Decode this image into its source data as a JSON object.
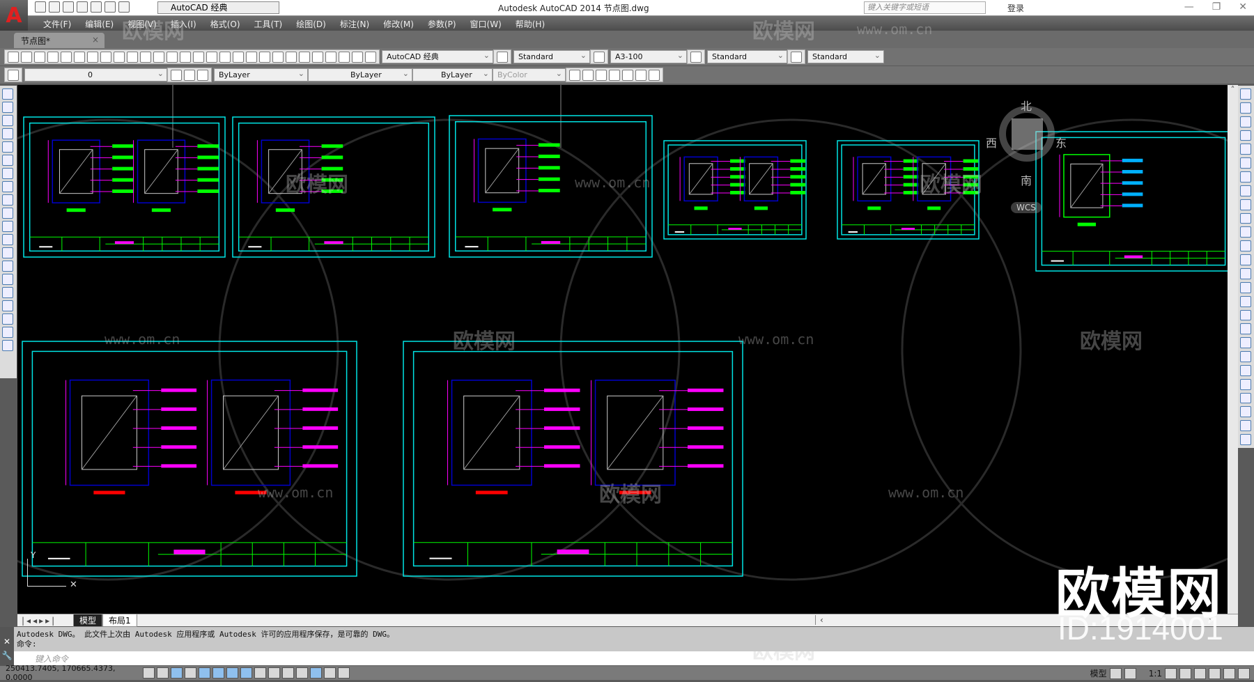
{
  "titlebar": {
    "workspace": "AutoCAD 经典",
    "title": "Autodesk AutoCAD 2014    节点图.dwg",
    "search_placeholder": "键入关键字或短语",
    "login": "登录"
  },
  "menu": [
    "文件(F)",
    "编辑(E)",
    "视图(V)",
    "插入(I)",
    "格式(O)",
    "工具(T)",
    "绘图(D)",
    "标注(N)",
    "修改(M)",
    "参数(P)",
    "窗口(W)",
    "帮助(H)"
  ],
  "doc_tab": "节点图*",
  "toolbar1": {
    "workspace": "AutoCAD 经典",
    "text_style": "Standard",
    "dim_style": "A3-100",
    "table_style": "Standard",
    "mleader_style": "Standard"
  },
  "toolbar2": {
    "layer": "0",
    "color": "ByLayer",
    "linetype": "ByLayer",
    "lineweight": "ByLayer",
    "plot_style": "ByColor"
  },
  "viewcube": {
    "north": "北",
    "south": "南",
    "east": "东",
    "west": "西",
    "wcs": "WCS"
  },
  "layout_tabs": [
    "模型",
    "布局1"
  ],
  "command": {
    "history": "Autodesk DWG。  此文件上次由 Autodesk 应用程序或 Autodesk 许可的应用程序保存，是可靠的 DWG。",
    "prompt": "命令:",
    "placeholder": "键入命令"
  },
  "status": {
    "coords": "250413.7405, 170665.4373, 0.0000",
    "model": "模型",
    "scale": "1:1"
  },
  "watermark": {
    "brand": "欧模网",
    "id": "ID:1914001",
    "url": "www.om.cn"
  },
  "colors": {
    "sheet": "#00e5e5",
    "green": "#00ff00",
    "magenta": "#ff00ff",
    "blue": "#0000cc",
    "red": "#ff0000"
  }
}
